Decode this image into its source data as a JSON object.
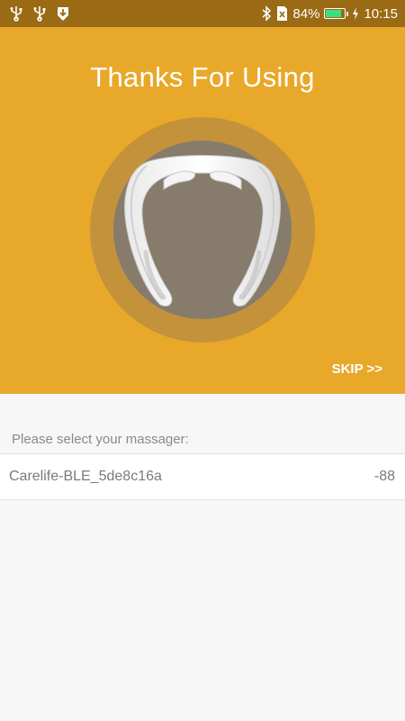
{
  "status_bar": {
    "icons_left": [
      "usb-icon",
      "usb-icon",
      "shield-download-icon"
    ],
    "bluetooth_icon": "bluetooth-icon",
    "sim_icon": "no-sim-icon",
    "battery_percent": "84%",
    "battery_level": 0.84,
    "charging_icon": "bolt-icon",
    "time": "10:15"
  },
  "hero": {
    "title": "Thanks For Using",
    "image": "neck-massager-icon",
    "skip_label": "SKIP >>"
  },
  "devices": {
    "prompt": "Please select your massager:",
    "items": [
      {
        "name": "Carelife-BLE_5de8c16a",
        "rssi": "-88"
      }
    ]
  },
  "colors": {
    "status_bar": "#9a6a14",
    "accent": "#e8a829",
    "ring_outer": "#c3923a",
    "ring_inner": "#877c6c",
    "battery_fill": "#39e07f",
    "background": "#f7f7f7"
  }
}
